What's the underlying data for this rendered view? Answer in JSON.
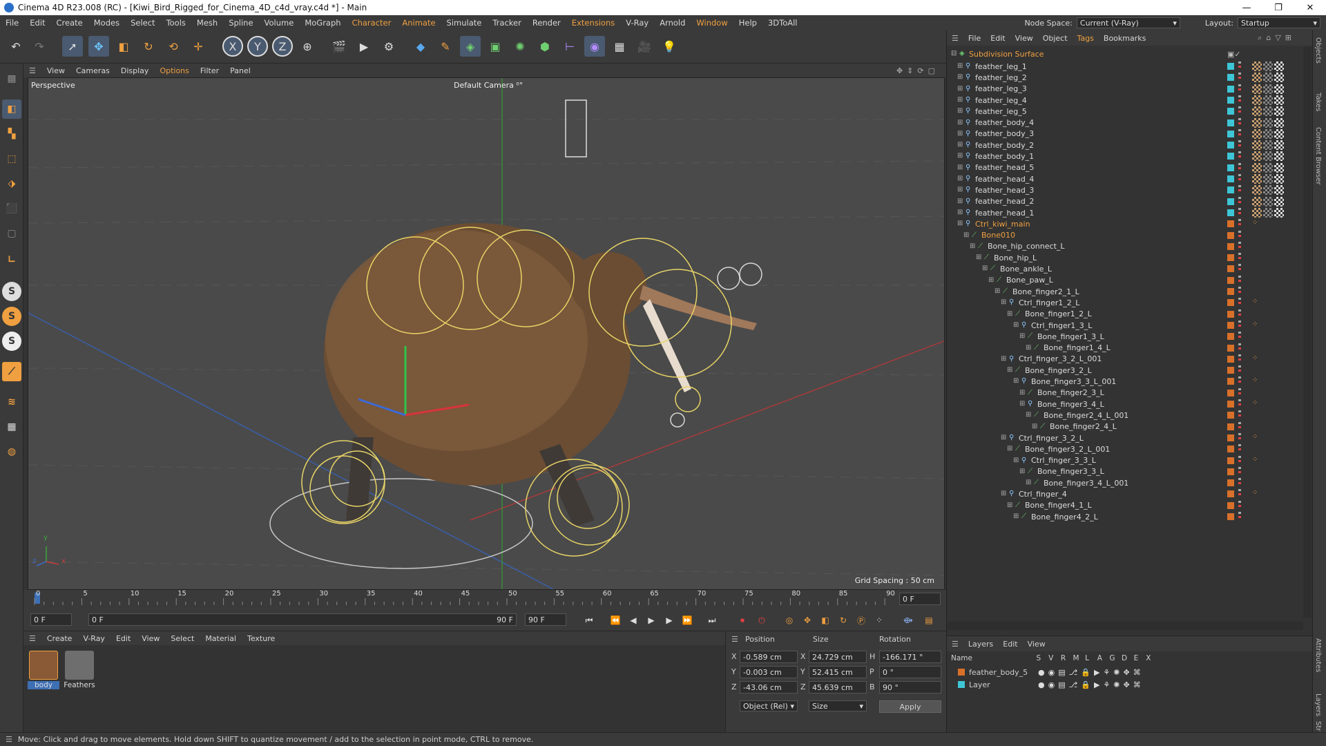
{
  "window": {
    "title": "Cinema 4D R23.008 (RC) - [Kiwi_Bird_Rigged_for_Cinema_4D_c4d_vray.c4d *] - Main",
    "controls": [
      "—",
      "❐",
      "✕"
    ]
  },
  "menubar": {
    "items": [
      "File",
      "Edit",
      "Create",
      "Modes",
      "Select",
      "Tools",
      "Mesh",
      "Spline",
      "Volume",
      "MoGraph",
      "Character",
      "Animate",
      "Simulate",
      "Tracker",
      "Render",
      "Extensions",
      "V-Ray",
      "Arnold",
      "Window",
      "Help",
      "3DToAll"
    ],
    "node_space_label": "Node Space:",
    "node_space_value": "Current (V-Ray)",
    "layout_label": "Layout:",
    "layout_value": "Startup"
  },
  "viewport": {
    "menu": [
      "View",
      "Cameras",
      "Display",
      "Options",
      "Filter",
      "Panel"
    ],
    "view_name": "Perspective",
    "camera": "Default Camera",
    "camera_suffix": "⁰°",
    "grid_spacing": "Grid Spacing : 50 cm",
    "axis_y": "y",
    "axis_z": "z",
    "axis_x": "x"
  },
  "timeline": {
    "ticks": [
      "0",
      "5",
      "10",
      "15",
      "20",
      "25",
      "30",
      "35",
      "40",
      "45",
      "50",
      "55",
      "60",
      "65",
      "70",
      "75",
      "80",
      "85",
      "90"
    ],
    "current_frame_right": "0 F",
    "start_field": "0 F",
    "range_start": "0 F",
    "range_end": "90 F",
    "end_field": "90 F"
  },
  "materials": {
    "menu": [
      "Create",
      "V-Ray",
      "Edit",
      "View",
      "Select",
      "Material",
      "Texture"
    ],
    "items": [
      {
        "name": "body",
        "color": "#8a5a36"
      },
      {
        "name": "Feathers",
        "color": "#6e6e6e"
      }
    ]
  },
  "coordinates": {
    "headers": [
      "Position",
      "Size",
      "Rotation"
    ],
    "rows": [
      {
        "axis": "X",
        "pos": "-0.589 cm",
        "size_axis": "X",
        "size": "24.729 cm",
        "rot_axis": "H",
        "rot": "-166.171 °"
      },
      {
        "axis": "Y",
        "pos": "-0.003 cm",
        "size_axis": "Y",
        "size": "52.415 cm",
        "rot_axis": "P",
        "rot": "0 °"
      },
      {
        "axis": "Z",
        "pos": "-43.06 cm",
        "size_axis": "Z",
        "size": "45.639 cm",
        "rot_axis": "B",
        "rot": "90 °"
      }
    ],
    "mode": "Object (Rel)",
    "size_mode": "Size",
    "apply": "Apply"
  },
  "object_manager": {
    "menu": [
      "File",
      "Edit",
      "View",
      "Object",
      "Tags",
      "Bookmarks"
    ],
    "root": "Subdivision Surface",
    "items": [
      {
        "name": "feather_leg_1",
        "depth": 1,
        "kind": "mesh"
      },
      {
        "name": "feather_leg_2",
        "depth": 1,
        "kind": "mesh"
      },
      {
        "name": "feather_leg_3",
        "depth": 1,
        "kind": "mesh"
      },
      {
        "name": "feather_leg_4",
        "depth": 1,
        "kind": "mesh"
      },
      {
        "name": "feather_leg_5",
        "depth": 1,
        "kind": "mesh"
      },
      {
        "name": "feather_body_4",
        "depth": 1,
        "kind": "mesh"
      },
      {
        "name": "feather_body_3",
        "depth": 1,
        "kind": "mesh"
      },
      {
        "name": "feather_body_2",
        "depth": 1,
        "kind": "mesh"
      },
      {
        "name": "feather_body_1",
        "depth": 1,
        "kind": "mesh"
      },
      {
        "name": "feather_head_5",
        "depth": 1,
        "kind": "mesh"
      },
      {
        "name": "feather_head_4",
        "depth": 1,
        "kind": "mesh"
      },
      {
        "name": "feather_head_3",
        "depth": 1,
        "kind": "mesh"
      },
      {
        "name": "feather_head_2",
        "depth": 1,
        "kind": "mesh"
      },
      {
        "name": "feather_head_1",
        "depth": 1,
        "kind": "mesh"
      },
      {
        "name": "Ctrl_kiwi_main",
        "depth": 1,
        "kind": "ctrl",
        "orange": true
      },
      {
        "name": "Bone010",
        "depth": 2,
        "kind": "bone",
        "orange": true
      },
      {
        "name": "Bone_hip_connect_L",
        "depth": 3,
        "kind": "bone"
      },
      {
        "name": "Bone_hip_L",
        "depth": 4,
        "kind": "bone"
      },
      {
        "name": "Bone_ankle_L",
        "depth": 5,
        "kind": "bone"
      },
      {
        "name": "Bone_paw_L",
        "depth": 6,
        "kind": "bone"
      },
      {
        "name": "Bone_finger2_1_L",
        "depth": 7,
        "kind": "bone"
      },
      {
        "name": "Ctrl_finger1_2_L",
        "depth": 8,
        "kind": "ctrl"
      },
      {
        "name": "Bone_finger1_2_L",
        "depth": 9,
        "kind": "bone"
      },
      {
        "name": "Ctrl_finger1_3_L",
        "depth": 10,
        "kind": "ctrl"
      },
      {
        "name": "Bone_finger1_3_L",
        "depth": 11,
        "kind": "bone"
      },
      {
        "name": "Bone_finger1_4_L",
        "depth": 12,
        "kind": "bone"
      },
      {
        "name": "Ctrl_finger_3_2_L_001",
        "depth": 8,
        "kind": "ctrl"
      },
      {
        "name": "Bone_finger3_2_L",
        "depth": 9,
        "kind": "bone"
      },
      {
        "name": "Bone_finger3_3_L_001",
        "depth": 10,
        "kind": "ctrl"
      },
      {
        "name": "Bone_finger2_3_L",
        "depth": 11,
        "kind": "bone"
      },
      {
        "name": "Bone_finger3_4_L",
        "depth": 11,
        "kind": "ctrl"
      },
      {
        "name": "Bone_finger2_4_L_001",
        "depth": 12,
        "kind": "bone"
      },
      {
        "name": "Bone_finger2_4_L",
        "depth": 13,
        "kind": "bone"
      },
      {
        "name": "Ctrl_finger_3_2_L",
        "depth": 8,
        "kind": "ctrl"
      },
      {
        "name": "Bone_finger3_2_L_001",
        "depth": 9,
        "kind": "bone"
      },
      {
        "name": "Ctrl_finger_3_3_L",
        "depth": 10,
        "kind": "ctrl"
      },
      {
        "name": "Bone_finger3_3_L",
        "depth": 11,
        "kind": "bone"
      },
      {
        "name": "Bone_finger3_4_L_001",
        "depth": 12,
        "kind": "bone"
      },
      {
        "name": "Ctrl_finger_4",
        "depth": 8,
        "kind": "ctrl"
      },
      {
        "name": "Bone_finger4_1_L",
        "depth": 9,
        "kind": "bone"
      },
      {
        "name": "Bone_finger4_2_L",
        "depth": 10,
        "kind": "bone"
      }
    ]
  },
  "layers": {
    "menu": [
      "Layers",
      "Edit",
      "View"
    ],
    "columns": [
      "Name",
      "S",
      "V",
      "R",
      "M",
      "L",
      "A",
      "G",
      "D",
      "E",
      "X"
    ],
    "rows": [
      {
        "name": "feather_body_5",
        "color": "#d8702a"
      },
      {
        "name": "Layer",
        "color": "#3ec6d6"
      }
    ]
  },
  "right_strip": [
    "Objects",
    "Takes",
    "Content Browser",
    "Attributes",
    "Layers",
    "Str"
  ],
  "status": "Move: Click and drag to move elements. Hold down SHIFT to quantize movement / add to the selection in point mode, CTRL to remove.",
  "colors": {
    "accent": "#f0a040",
    "cyan": "#3ec6d6",
    "orange": "#d8702a",
    "green_bone": "#6fd070"
  }
}
